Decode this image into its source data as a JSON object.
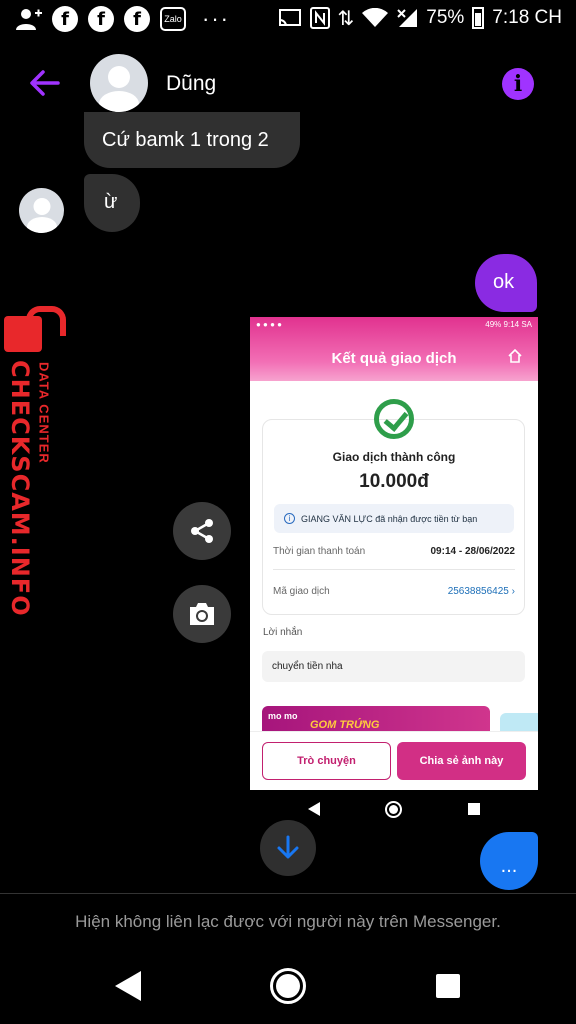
{
  "status_bar": {
    "zalo_label": "Zalo",
    "more": "···",
    "battery": "75%",
    "time": "7:18 CH",
    "icons": [
      "add-person-icon",
      "facebook-icon",
      "facebook-icon",
      "facebook-icon",
      "zalo-icon",
      "cast-icon",
      "nfc-icon",
      "data-arrows-icon",
      "wifi-icon",
      "signal-icon",
      "battery-icon"
    ]
  },
  "header": {
    "contact_name": "Dũng",
    "back_icon": "arrow-left-icon",
    "info_icon": "info-icon",
    "info_glyph": "i",
    "accent_color": "#a033ff"
  },
  "messages": [
    {
      "direction": "in",
      "text": "Cứ bamk 1 trong 2"
    },
    {
      "direction": "in",
      "text": "ừ"
    },
    {
      "direction": "out",
      "text": "ok"
    }
  ],
  "watermark": {
    "main": "CHECKSCAM.INFO",
    "sub": "DATA CENTER",
    "color": "#e8282b"
  },
  "attachment": {
    "status_bar": {
      "battery": "49%",
      "time": "9:14 SA"
    },
    "title": "Kết quả giao dịch",
    "status": "Giao dịch thành công",
    "amount": "10.000đ",
    "notice": "GIANG VĂN LỰC đã nhận được tiền từ bạn",
    "rows": [
      {
        "label": "Thời gian thanh toán",
        "value": "09:14 - 28/06/2022"
      },
      {
        "label": "Mã giao dịch",
        "value": "25638856425"
      }
    ],
    "message_label": "Lời nhắn",
    "message": "chuyển tiền nha",
    "banner_logo": "mo mo",
    "banner_text": "GOM TRỨNG",
    "buttons": {
      "chat": "Trò chuyện",
      "share": "Chia sẻ ảnh này"
    },
    "brand_color": "#d22f85"
  },
  "actions": {
    "share_icon": "share-icon",
    "camera_icon": "camera-icon",
    "scroll_icon": "arrow-down-icon",
    "typing": "..."
  },
  "footer": {
    "notice": "Hiện không liên lạc được với người này trên Messenger."
  }
}
